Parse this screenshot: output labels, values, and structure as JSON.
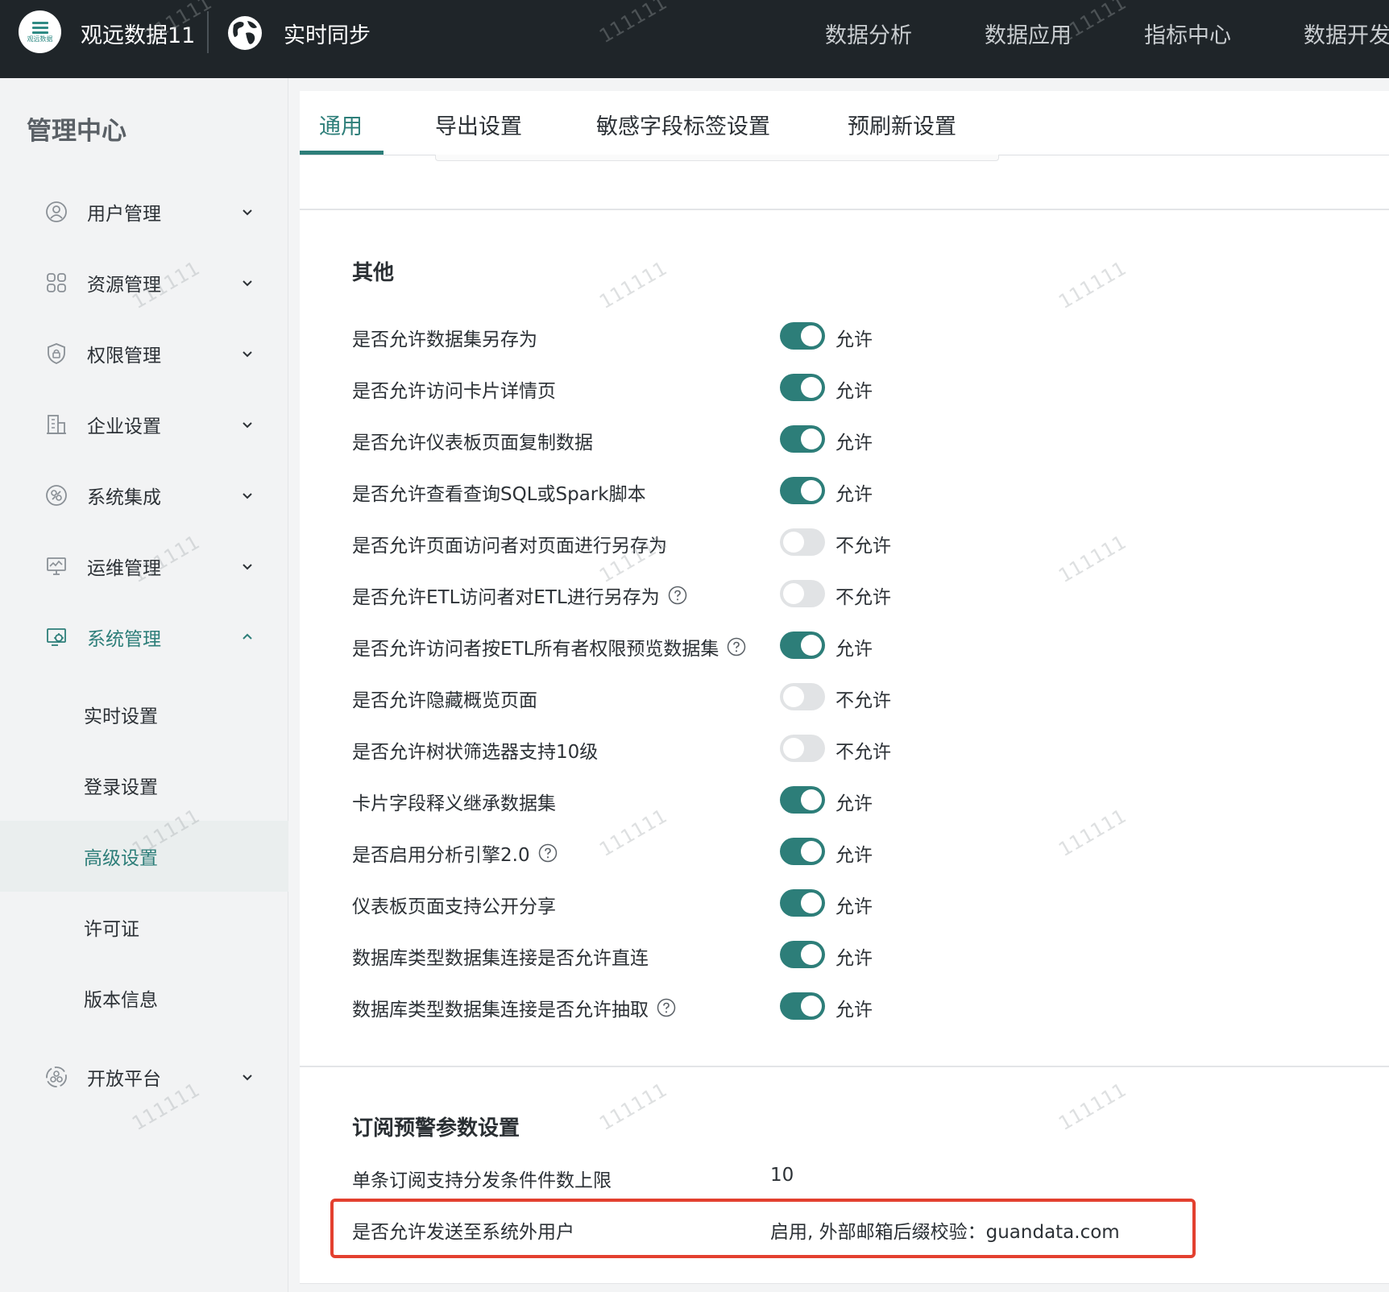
{
  "header": {
    "logo_text": "观远数据",
    "brand": "观远数据11",
    "realtime_label": "实时同步",
    "nav": [
      "数据分析",
      "数据应用",
      "指标中心",
      "数据开发"
    ]
  },
  "sidebar": {
    "title": "管理中心",
    "menu": [
      {
        "label": "用户管理",
        "icon": "user-icon"
      },
      {
        "label": "资源管理",
        "icon": "grid-icon"
      },
      {
        "label": "权限管理",
        "icon": "shield-icon"
      },
      {
        "label": "企业设置",
        "icon": "building-icon"
      },
      {
        "label": "系统集成",
        "icon": "integration-icon"
      },
      {
        "label": "运维管理",
        "icon": "monitor-icon"
      },
      {
        "label": "系统管理",
        "icon": "settings-icon"
      }
    ],
    "sub_menu": [
      "实时设置",
      "登录设置",
      "高级设置",
      "许可证",
      "版本信息"
    ],
    "open_platform": {
      "label": "开放平台",
      "icon": "platform-icon"
    }
  },
  "tabs": [
    "通用",
    "导出设置",
    "敏感字段标签设置",
    "预刷新设置"
  ],
  "other_section": {
    "title": "其他",
    "rows": [
      {
        "label": "是否允许数据集另存为",
        "on": true,
        "status": "允许",
        "help": false
      },
      {
        "label": "是否允许访问卡片详情页",
        "on": true,
        "status": "允许",
        "help": false
      },
      {
        "label": "是否允许仪表板页面复制数据",
        "on": true,
        "status": "允许",
        "help": false
      },
      {
        "label": "是否允许查看查询SQL或Spark脚本",
        "on": true,
        "status": "允许",
        "help": false
      },
      {
        "label": "是否允许页面访问者对页面进行另存为",
        "on": false,
        "status": "不允许",
        "help": false
      },
      {
        "label": "是否允许ETL访问者对ETL进行另存为",
        "on": false,
        "status": "不允许",
        "help": true
      },
      {
        "label": "是否允许访问者按ETL所有者权限预览数据集",
        "on": true,
        "status": "允许",
        "help": true
      },
      {
        "label": "是否允许隐藏概览页面",
        "on": false,
        "status": "不允许",
        "help": false
      },
      {
        "label": "是否允许树状筛选器支持10级",
        "on": false,
        "status": "不允许",
        "help": false
      },
      {
        "label": "卡片字段释义继承数据集",
        "on": true,
        "status": "允许",
        "help": false
      },
      {
        "label": "是否启用分析引擎2.0",
        "on": true,
        "status": "允许",
        "help": true
      },
      {
        "label": "仪表板页面支持公开分享",
        "on": true,
        "status": "允许",
        "help": false
      },
      {
        "label": "数据库类型数据集连接是否允许直连",
        "on": true,
        "status": "允许",
        "help": false
      },
      {
        "label": "数据库类型数据集连接是否允许抽取",
        "on": true,
        "status": "允许",
        "help": true
      }
    ]
  },
  "subscription_section": {
    "title": "订阅预警参数设置",
    "rows": [
      {
        "label": "单条订阅支持分发条件件数上限",
        "value": "10"
      },
      {
        "label": "是否允许发送至系统外用户",
        "value": "启用, 外部邮箱后缀校验：guandata.com"
      }
    ]
  },
  "watermark": "111111",
  "colors": {
    "accent": "#2d7e79",
    "highlight": "#e3402f",
    "header_bg": "#1f2529"
  }
}
